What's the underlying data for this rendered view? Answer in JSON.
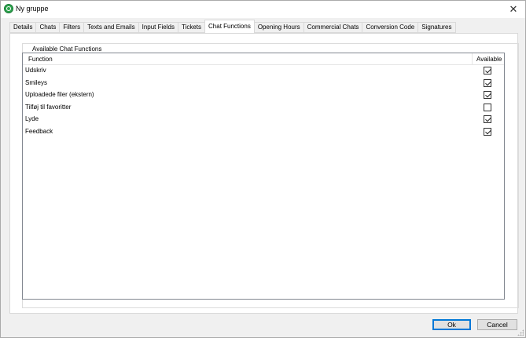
{
  "window": {
    "title": "Ny gruppe",
    "close_glyph": "✕"
  },
  "tabs": [
    {
      "label": "Details",
      "active": false
    },
    {
      "label": "Chats",
      "active": false
    },
    {
      "label": "Filters",
      "active": false
    },
    {
      "label": "Texts and Emails",
      "active": false
    },
    {
      "label": "Input Fields",
      "active": false
    },
    {
      "label": "Tickets",
      "active": false
    },
    {
      "label": "Chat Functions",
      "active": true
    },
    {
      "label": "Opening Hours",
      "active": false
    },
    {
      "label": "Commercial Chats",
      "active": false
    },
    {
      "label": "Conversion Code",
      "active": false
    },
    {
      "label": "Signatures",
      "active": false
    }
  ],
  "panel": {
    "group_label": "Available Chat Functions",
    "columns": {
      "function": "Function",
      "available": "Available"
    },
    "rows": [
      {
        "name": "Udskriv",
        "available": true
      },
      {
        "name": "Smileys",
        "available": true
      },
      {
        "name": "Uploadede filer (ekstern)",
        "available": true
      },
      {
        "name": "Tilføj til favoritter",
        "available": false
      },
      {
        "name": "Lyde",
        "available": true
      },
      {
        "name": "Feedback",
        "available": true
      }
    ]
  },
  "buttons": {
    "ok": "Ok",
    "cancel": "Cancel"
  },
  "icons": {
    "app": "app-logo-icon",
    "close": "close-icon",
    "grip": "resize-grip-icon"
  }
}
